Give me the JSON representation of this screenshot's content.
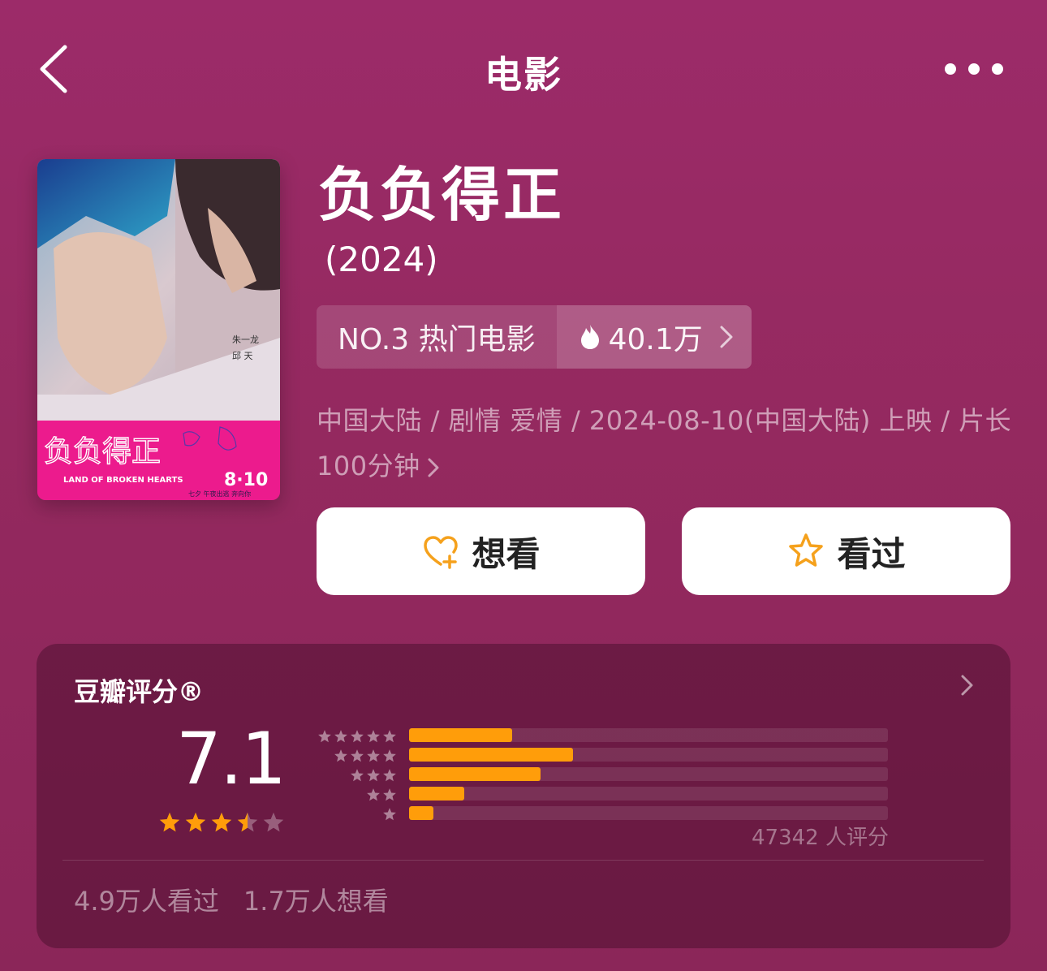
{
  "nav": {
    "title": "电影"
  },
  "movie": {
    "title": "负负得正",
    "year": "(2024)",
    "poster": {
      "title_cn": "负负得正",
      "title_en": "LAND OF BROKEN HEARTS",
      "date": "8·10",
      "tagline": "七夕 午夜出逃 奔向你",
      "cast_right": "朱一龙  邱天"
    },
    "rank": {
      "label": "NO.3 热门电影",
      "heat": "40.1万"
    },
    "meta": "中国大陆 / 剧情 爱情 / 2024-08-10(中国大陆) 上映 / 片长100分钟"
  },
  "actions": {
    "want_label": "想看",
    "seen_label": "看过"
  },
  "rating": {
    "header": "豆瓣评分®",
    "score": "7.1",
    "stars_value": 3.5,
    "distribution": [
      {
        "stars": 5,
        "percent": 21.6
      },
      {
        "stars": 4,
        "percent": 34.2
      },
      {
        "stars": 3,
        "percent": 27.5
      },
      {
        "stars": 2,
        "percent": 11.5
      },
      {
        "stars": 1,
        "percent": 5.0
      }
    ],
    "count_text": "47342 人评分",
    "seen_text": "4.9万人看过",
    "want_text": "1.7万人想看"
  },
  "colors": {
    "background": "#9c2b69",
    "accent_orange": "#ff9d0a",
    "poster_pink": "#ec1b8d"
  }
}
